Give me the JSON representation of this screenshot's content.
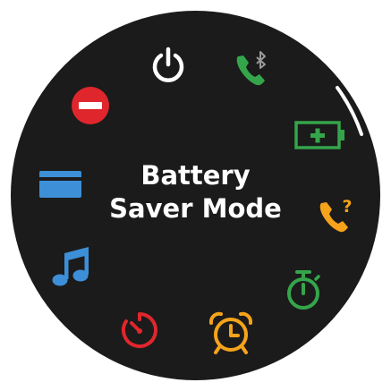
{
  "screen": {
    "title_line1": "Battery",
    "title_line2": "Saver Mode"
  },
  "controls": [
    {
      "id": "power",
      "icon": "power-icon",
      "color": "#ffffff"
    },
    {
      "id": "phone-bluetooth",
      "icon": "phone-bluetooth-icon",
      "color": "#35a54b"
    },
    {
      "id": "battery-saver",
      "icon": "battery-charge-icon",
      "color": "#35a54b"
    },
    {
      "id": "find-phone",
      "icon": "phone-question-icon",
      "color": "#f5a31a"
    },
    {
      "id": "stopwatch",
      "icon": "stopwatch-icon",
      "color": "#35a54b"
    },
    {
      "id": "alarm",
      "icon": "alarm-clock-icon",
      "color": "#f5a31a"
    },
    {
      "id": "timer",
      "icon": "timer-icon",
      "color": "#e0262d"
    },
    {
      "id": "music",
      "icon": "music-note-icon",
      "color": "#3d8fd8"
    },
    {
      "id": "wallet",
      "icon": "card-icon",
      "color": "#3d8fd8"
    },
    {
      "id": "do-not-disturb",
      "icon": "do-not-disturb-icon",
      "color": "#e0262d"
    }
  ],
  "scroll_indicator_color": "#ffffff"
}
